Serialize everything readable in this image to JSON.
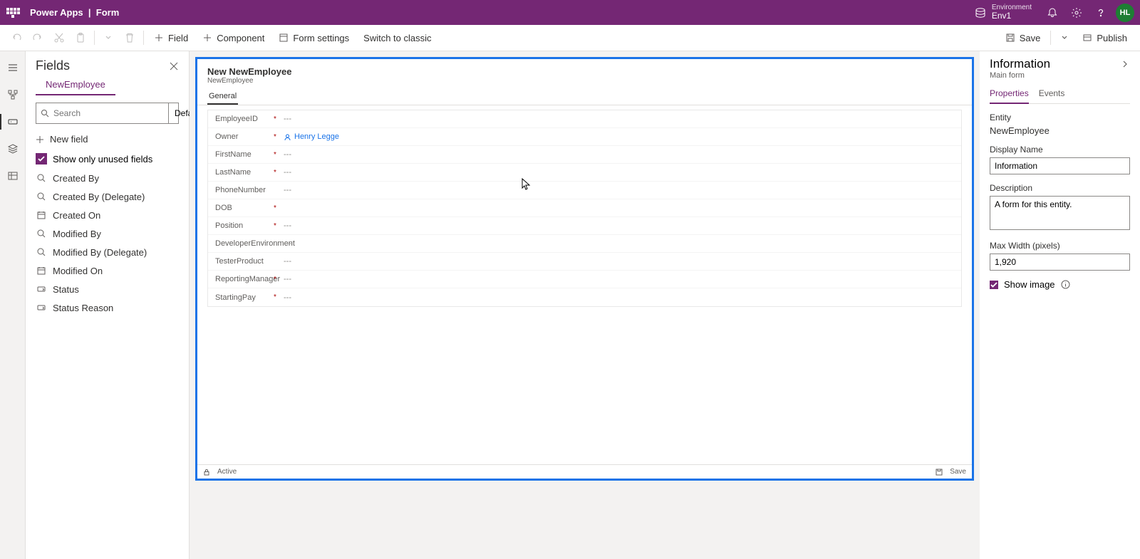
{
  "header": {
    "app_name": "Power Apps",
    "divider": "|",
    "page": "Form",
    "env_label": "Environment",
    "env_value": "Env1",
    "avatar_initials": "HL"
  },
  "commands": {
    "field": "Field",
    "component": "Component",
    "form_settings": "Form settings",
    "switch_classic": "Switch to classic",
    "save": "Save",
    "publish": "Publish"
  },
  "fields_panel": {
    "title": "Fields",
    "entity": "NewEmployee",
    "search_placeholder": "Search",
    "filter_label": "Default",
    "new_field": "New field",
    "show_unused": "Show only unused fields",
    "items": [
      {
        "icon": "lookup",
        "label": "Created By"
      },
      {
        "icon": "lookup",
        "label": "Created By (Delegate)"
      },
      {
        "icon": "datetime",
        "label": "Created On"
      },
      {
        "icon": "lookup",
        "label": "Modified By"
      },
      {
        "icon": "lookup",
        "label": "Modified By (Delegate)"
      },
      {
        "icon": "datetime",
        "label": "Modified On"
      },
      {
        "icon": "option",
        "label": "Status"
      },
      {
        "icon": "option",
        "label": "Status Reason"
      }
    ]
  },
  "canvas": {
    "title": "New NewEmployee",
    "subtitle": "NewEmployee",
    "tab": "General",
    "owner_name": "Henry Legge",
    "footer_status": "Active",
    "footer_save": "Save",
    "placeholder": "---",
    "rows": [
      {
        "label": "EmployeeID",
        "required": true,
        "type": "text"
      },
      {
        "label": "Owner",
        "required": true,
        "type": "owner"
      },
      {
        "label": "FirstName",
        "required": true,
        "type": "text"
      },
      {
        "label": "LastName",
        "required": true,
        "type": "text"
      },
      {
        "label": "PhoneNumber",
        "required": false,
        "type": "text"
      },
      {
        "label": "DOB",
        "required": true,
        "type": "blank"
      },
      {
        "label": "Position",
        "required": true,
        "type": "text"
      },
      {
        "label": "DeveloperEnvironment",
        "required": false,
        "type": "text"
      },
      {
        "label": "TesterProduct",
        "required": false,
        "type": "text"
      },
      {
        "label": "ReportingManager",
        "required": true,
        "type": "text"
      },
      {
        "label": "StartingPay",
        "required": true,
        "type": "text"
      }
    ]
  },
  "props": {
    "title": "Information",
    "subtitle": "Main form",
    "tab_properties": "Properties",
    "tab_events": "Events",
    "entity_label": "Entity",
    "entity_value": "NewEmployee",
    "display_name_label": "Display Name",
    "display_name_value": "Information",
    "description_label": "Description",
    "description_value": "A form for this entity.",
    "maxwidth_label": "Max Width (pixels)",
    "maxwidth_value": "1,920",
    "show_image": "Show image"
  }
}
